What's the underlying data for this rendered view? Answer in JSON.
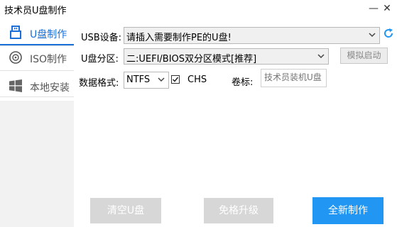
{
  "window": {
    "title": "技术员U盘制作",
    "minimize_glyph": "—",
    "close_glyph": "✕"
  },
  "sidebar": {
    "items": [
      {
        "label": "U盘制作",
        "icon": "usb-icon",
        "active": true
      },
      {
        "label": "ISO制作",
        "icon": "disc-icon",
        "active": false
      },
      {
        "label": "本地安装",
        "icon": "windows-icon",
        "active": false
      }
    ]
  },
  "form": {
    "usb_device": {
      "label": "USB设备:",
      "value": "请插入需要制作PE的U盘!"
    },
    "partition": {
      "label": "U盘分区:",
      "value": "二:UEFI/BIOS双分区模式[推荐]"
    },
    "format": {
      "label": "数据格式:",
      "value": "NTFS"
    },
    "chs": {
      "label": "CHS",
      "checked": true
    },
    "volume": {
      "label": "卷标:",
      "placeholder": "技术员装机U盘"
    },
    "simulate_label": "模拟启动",
    "refresh_icon": "refresh-icon"
  },
  "actions": {
    "clear": "清空U盘",
    "upgrade": "免格升级",
    "create": "全新制作"
  },
  "colors": {
    "accent": "#2196f3",
    "active_text": "#1a6fd8",
    "disabled_button": "#d7d7d7"
  }
}
